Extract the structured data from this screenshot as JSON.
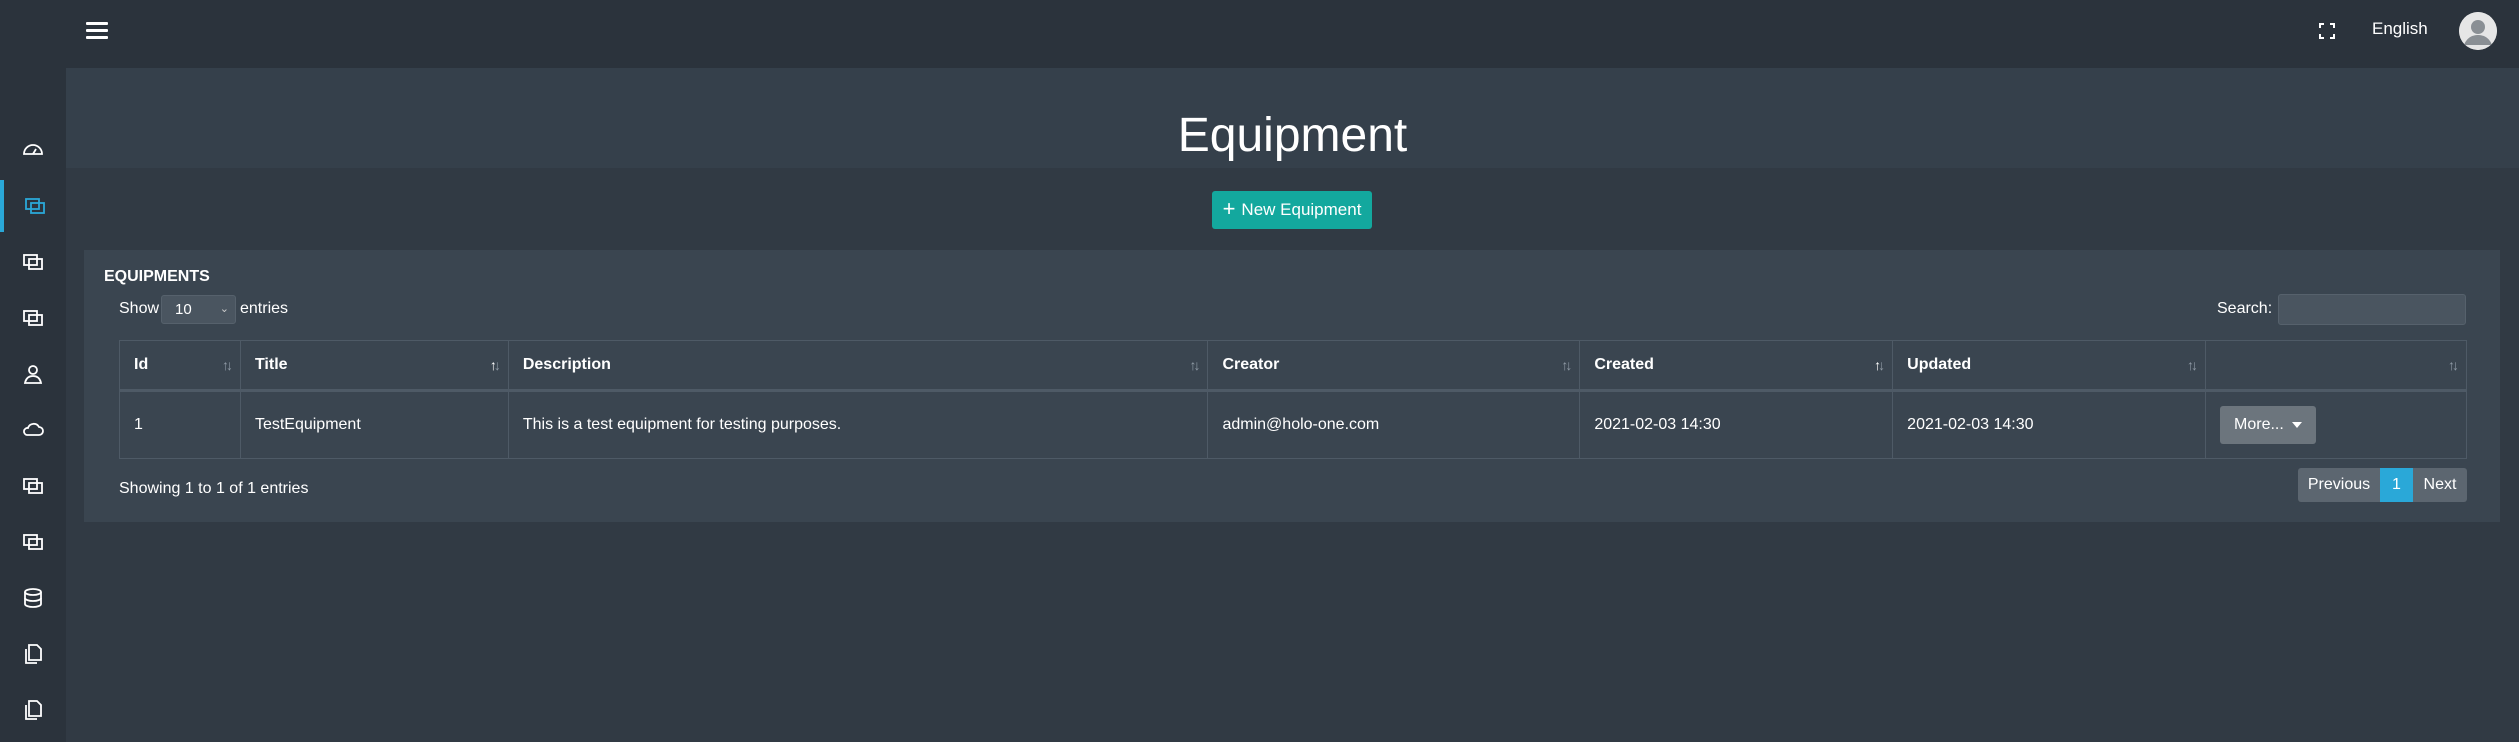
{
  "header": {
    "language": "English",
    "menu_icon": "hamburger-icon",
    "fullscreen_icon": "fullscreen-icon",
    "avatar_icon": "user-avatar-icon"
  },
  "sidebar": {
    "items": [
      {
        "icon": "dashboard-gauge-icon",
        "active": false
      },
      {
        "icon": "equipment-windows-icon",
        "active": true
      },
      {
        "icon": "windows-icon",
        "active": false
      },
      {
        "icon": "windows-icon",
        "active": false
      },
      {
        "icon": "user-icon",
        "active": false
      },
      {
        "icon": "cloud-icon",
        "active": false
      },
      {
        "icon": "windows-icon",
        "active": false
      },
      {
        "icon": "windows-icon",
        "active": false
      },
      {
        "icon": "database-icon",
        "active": false
      },
      {
        "icon": "copy-files-icon",
        "active": false
      },
      {
        "icon": "copy-files-icon",
        "active": false
      }
    ],
    "accent_color": "#2aa8d8"
  },
  "page": {
    "title": "Equipment",
    "new_button_label": "New Equipment",
    "new_button_color": "#13a89e"
  },
  "panel": {
    "title": "EQUIPMENTS",
    "show_label": "Show",
    "page_size": "10",
    "entries_label": "entries",
    "search_label": "Search:",
    "search_value": ""
  },
  "table": {
    "columns": [
      "Id",
      "Title",
      "Description",
      "Creator",
      "Created",
      "Updated",
      ""
    ],
    "rows": [
      {
        "id": "1",
        "title": "TestEquipment",
        "description": "This is a test equipment for testing purposes.",
        "creator": "admin@holo-one.com",
        "created": "2021-02-03 14:30",
        "updated": "2021-02-03 14:30",
        "action_label": "More..."
      }
    ]
  },
  "footer": {
    "info": "Showing 1 to 1 of 1 entries",
    "prev_label": "Previous",
    "current_page": "1",
    "next_label": "Next"
  }
}
